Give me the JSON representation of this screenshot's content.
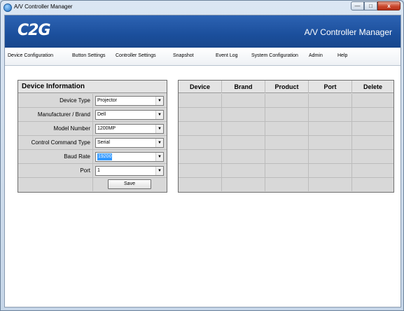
{
  "window": {
    "title": "A/V Controller Manager",
    "minimize": "—",
    "maximize": "□",
    "close": "x"
  },
  "banner": {
    "logo": "C2G",
    "title": "A/V Controller Manager"
  },
  "menu": [
    "Device Configuration",
    "Button Settings",
    "Controller Settings",
    "Snapshot",
    "Event Log",
    "System Configuration",
    "Admin",
    "Help"
  ],
  "device_info": {
    "heading": "Device Information",
    "fields": [
      {
        "label": "Device Type",
        "value": "Projector"
      },
      {
        "label": "Manufacturer / Brand",
        "value": "Dell"
      },
      {
        "label": "Model Number",
        "value": "1200MP"
      },
      {
        "label": "Control Command Type",
        "value": "Serial"
      },
      {
        "label": "Baud Rate",
        "value": "19200"
      },
      {
        "label": "Port",
        "value": "1"
      }
    ],
    "save_label": "Save"
  },
  "device_table": {
    "columns": [
      "Device",
      "Brand",
      "Product",
      "Port",
      "Delete"
    ],
    "rows": []
  }
}
